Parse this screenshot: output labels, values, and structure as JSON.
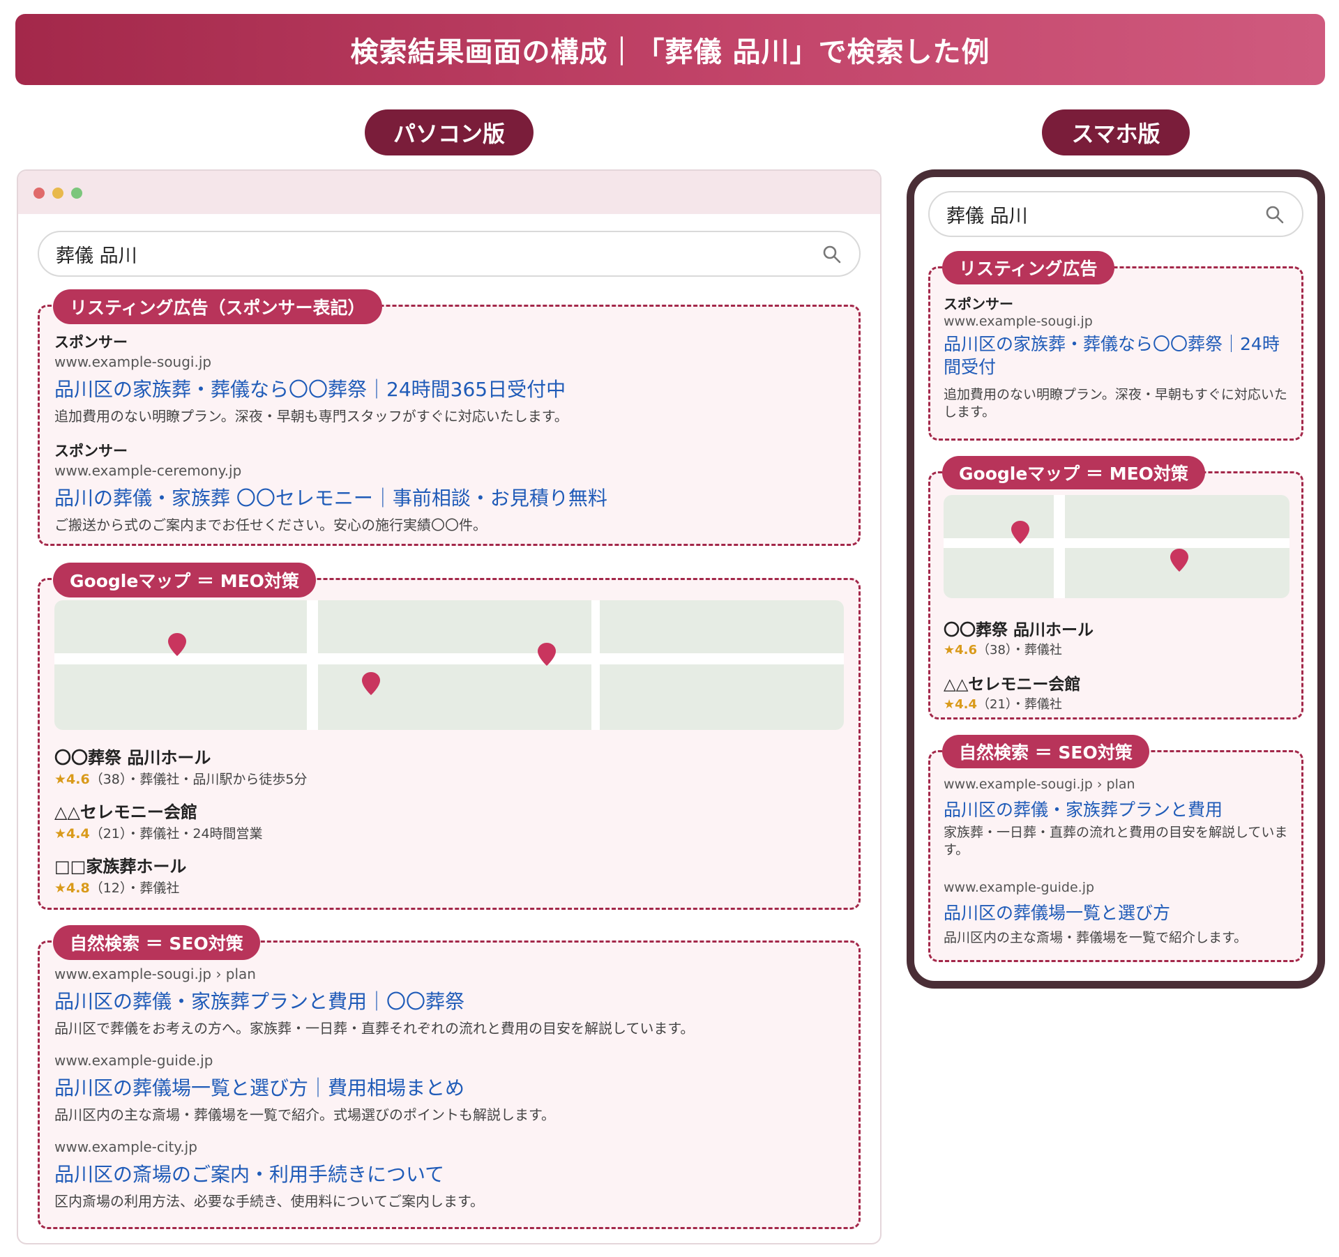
{
  "banner": {
    "title": "検索結果画面の構成｜「葬儀 品川」で検索した例"
  },
  "versions": {
    "pc": "パソコン版",
    "sp": "スマホ版"
  },
  "colors": {
    "accent": "#b8345a",
    "dark": "#7a1d3a",
    "link": "#1f5bb8",
    "star": "#d99a1a",
    "map": "#e6ece4"
  },
  "pc": {
    "search_query": "葬儀 品川",
    "ads": {
      "label": "リスティング広告（スポンサー表記）",
      "items": [
        {
          "sponsor": "スポンサー",
          "url": "www.example-sougi.jp",
          "title": "品川区の家族葬・葬儀なら〇〇葬祭｜24時間365日受付中",
          "desc": "追加費用のない明瞭プラン。深夜・早朝も専門スタッフがすぐに対応いたします。"
        },
        {
          "sponsor": "スポンサー",
          "url": "www.example-ceremony.jp",
          "title": "品川の葬儀・家族葬 〇〇セレモニー｜事前相談・お見積り無料",
          "desc": "ご搬送から式のご案内までお任せください。安心の施行実績〇〇件。"
        }
      ]
    },
    "map": {
      "label": "Googleマップ ＝ MEO対策",
      "places": [
        {
          "name": "〇〇葬祭 品川ホール",
          "rating": "★4.6",
          "meta": "（38）・葬儀社・品川駅から徒歩5分"
        },
        {
          "name": "△△セレモニー会館",
          "rating": "★4.4",
          "meta": "（21）・葬儀社・24時間営業"
        },
        {
          "name": "□□家族葬ホール",
          "rating": "★4.8",
          "meta": "（12）・葬儀社"
        }
      ]
    },
    "organic": {
      "label": "自然検索 ＝ SEO対策",
      "items": [
        {
          "url": "www.example-sougi.jp › plan",
          "title": "品川区の葬儀・家族葬プランと費用｜〇〇葬祭",
          "desc": "品川区で葬儀をお考えの方へ。家族葬・一日葬・直葬それぞれの流れと費用の目安を解説しています。"
        },
        {
          "url": "www.example-guide.jp",
          "title": "品川区の葬儀場一覧と選び方｜費用相場まとめ",
          "desc": "品川区内の主な斎場・葬儀場を一覧で紹介。式場選びのポイントも解説します。"
        },
        {
          "url": "www.example-city.jp",
          "title": "品川区の斎場のご案内・利用手続きについて",
          "desc": "区内斎場の利用方法、必要な手続き、使用料についてご案内します。"
        }
      ]
    }
  },
  "sp": {
    "search_query": "葬儀 品川",
    "ads": {
      "label": "リスティング広告",
      "items": [
        {
          "sponsor": "スポンサー",
          "url": "www.example-sougi.jp",
          "title": "品川区の家族葬・葬儀なら〇〇葬祭｜24時間受付",
          "desc": "追加費用のない明瞭プラン。深夜・早朝もすぐに対応いたします。"
        }
      ]
    },
    "map": {
      "label": "Googleマップ ＝ MEO対策",
      "places": [
        {
          "name": "〇〇葬祭 品川ホール",
          "rating": "★4.6",
          "meta": "（38）・葬儀社"
        },
        {
          "name": "△△セレモニー会館",
          "rating": "★4.4",
          "meta": "（21）・葬儀社"
        }
      ]
    },
    "organic": {
      "label": "自然検索 ＝ SEO対策",
      "items": [
        {
          "url": "www.example-sougi.jp › plan",
          "title": "品川区の葬儀・家族葬プランと費用",
          "desc": "家族葬・一日葬・直葬の流れと費用の目安を解説しています。"
        },
        {
          "url": "www.example-guide.jp",
          "title": "品川区の葬儀場一覧と選び方",
          "desc": "品川区内の主な斎場・葬儀場を一覧で紹介します。"
        }
      ]
    }
  }
}
